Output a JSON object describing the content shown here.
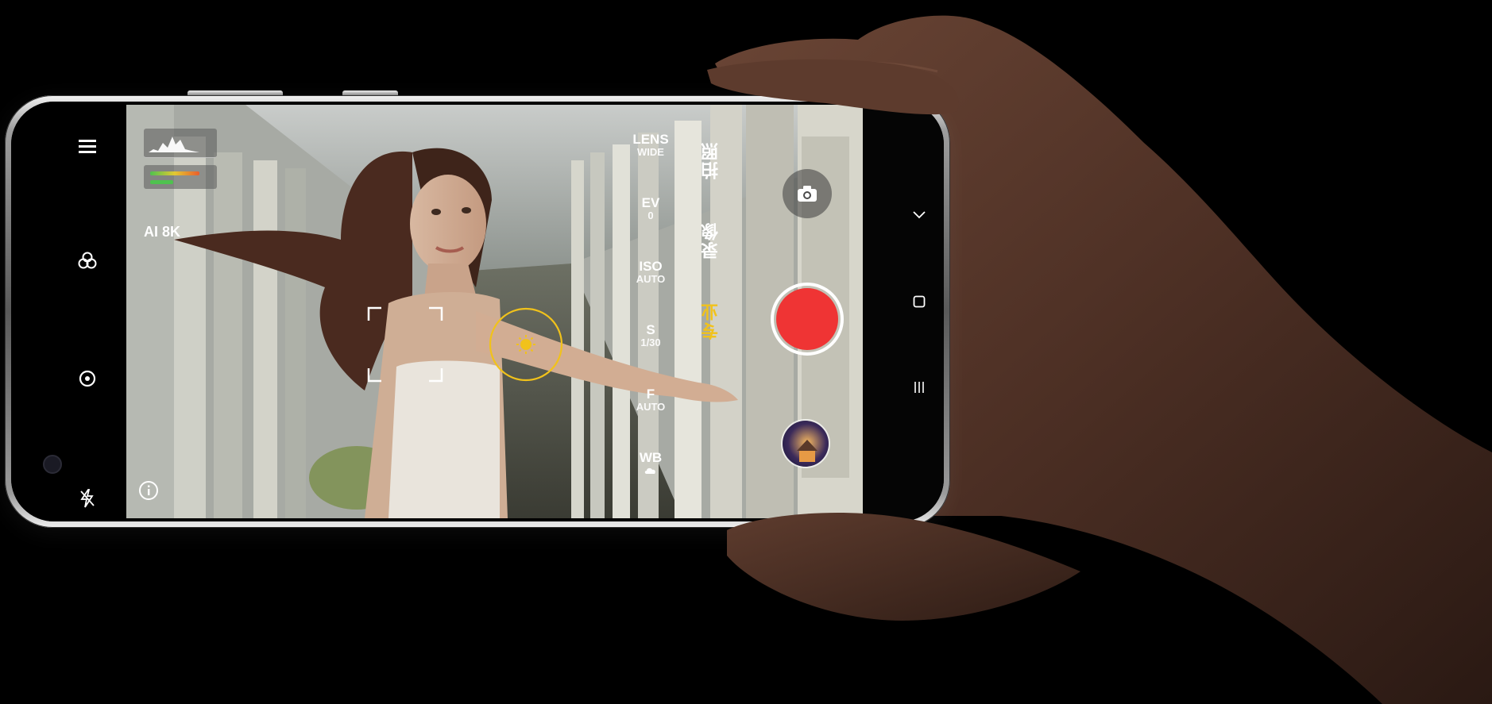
{
  "app": {
    "resolution_badge": "AI 8K"
  },
  "pro_settings": [
    {
      "key": "LENS",
      "value": "WIDE"
    },
    {
      "key": "EV",
      "value": "0"
    },
    {
      "key": "ISO",
      "value": "AUTO"
    },
    {
      "key": "S",
      "value": "1/30"
    },
    {
      "key": "F",
      "value": "AUTO"
    },
    {
      "key": "WB",
      "value": "cloudy-icon"
    }
  ],
  "modes": [
    {
      "label": "拍照",
      "active": false
    },
    {
      "label": "录像",
      "active": false
    },
    {
      "label": "专业",
      "active": true
    }
  ],
  "level_meter": {
    "bar1": 0.82,
    "bar2": 0.38
  },
  "colors": {
    "accent": "#f1c21b",
    "record": "#ef3434",
    "bar_start": "#4fc24f",
    "bar_end": "#ea5d2c"
  },
  "left_toolbar": [
    "menu-icon",
    "filters-icon",
    "focus-mode-icon",
    "flash-off-icon"
  ],
  "nav_bar": [
    "back-icon",
    "home-icon",
    "recents-icon"
  ]
}
